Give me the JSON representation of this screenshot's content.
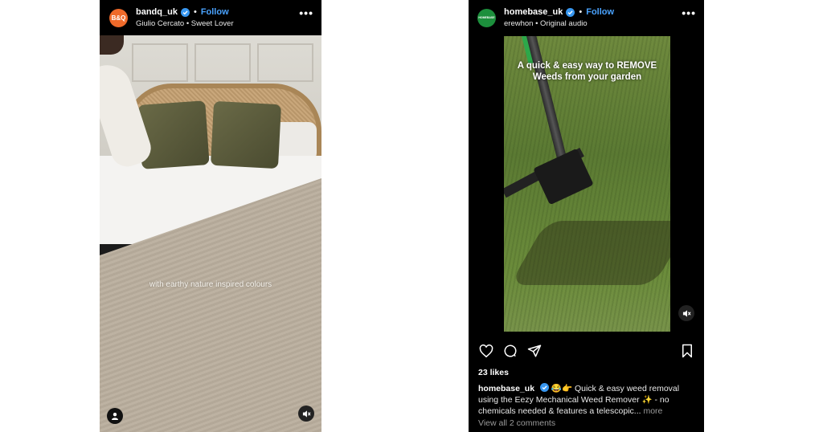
{
  "left_post": {
    "avatar_text": "B&Q",
    "username": "bandq_uk",
    "separator": "•",
    "follow_label": "Follow",
    "subtitle": "Giulio Cercato • Sweet Lover",
    "more_icon": "more-horizontal-icon",
    "overlay_text": "with earthy nature inspired colours",
    "colors": {
      "avatar": "#ef6a2a",
      "follow": "#4aa3ff"
    }
  },
  "right_post": {
    "avatar_text": "HOMEBASE",
    "username": "homebase_uk",
    "separator": "•",
    "follow_label": "Follow",
    "subtitle": "erewhon • Original audio",
    "video_title": "A quick & easy way to REMOVE Weeds from your garden",
    "likes": "23 likes",
    "caption_user": "homebase_uk",
    "caption_text": "😂👉 Quick & easy weed removal using the Eezy Mechanical Weed Remover ✨ - no chemicals needed & features a telescopic...",
    "caption_more": "more",
    "view_comments": "View all 2 comments",
    "colors": {
      "avatar": "#1c8f3c",
      "follow": "#4aa3ff"
    }
  }
}
